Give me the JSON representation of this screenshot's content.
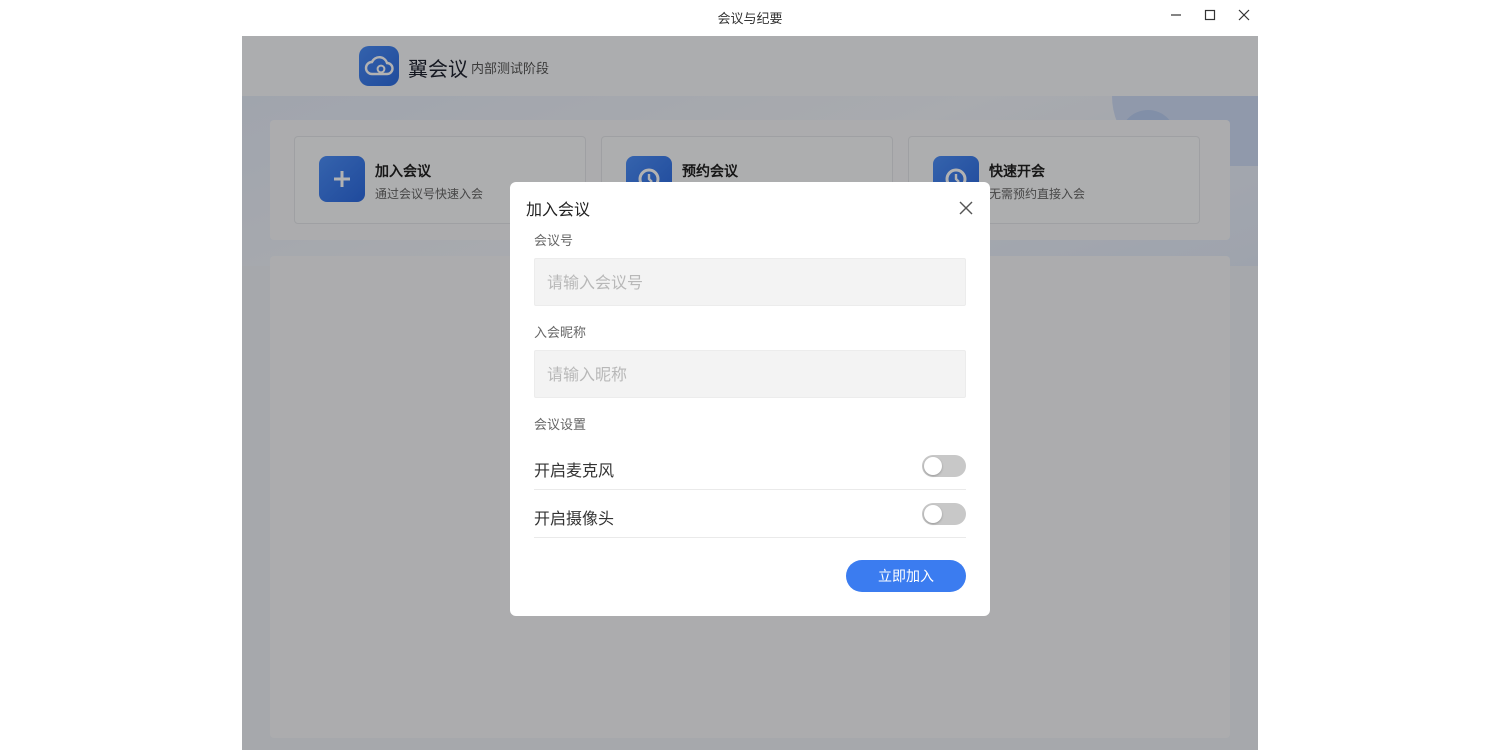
{
  "window": {
    "title": "会议与纪要"
  },
  "app": {
    "brand": "翼会议",
    "brand_sub": "内部测试阶段"
  },
  "actions": [
    {
      "title": "加入会议",
      "desc": "通过会议号快速入会"
    },
    {
      "title": "预约会议",
      "desc": ""
    },
    {
      "title": "快速开会",
      "desc": "无需预约直接入会"
    }
  ],
  "dialog": {
    "title": "加入会议",
    "meeting_id_label": "会议号",
    "meeting_id_placeholder": "请输入会议号",
    "meeting_id_value": "",
    "nickname_label": "入会昵称",
    "nickname_placeholder": "请输入昵称",
    "nickname_value": "",
    "settings_label": "会议设置",
    "settings": [
      {
        "label": "开启麦克风",
        "enabled": false
      },
      {
        "label": "开启摄像头",
        "enabled": false
      }
    ],
    "submit_label": "立即加入"
  },
  "colors": {
    "accent": "#3b7cf0",
    "toggle_off": "#c8c8c8",
    "overlay": "rgba(0,0,0,0.30)"
  }
}
